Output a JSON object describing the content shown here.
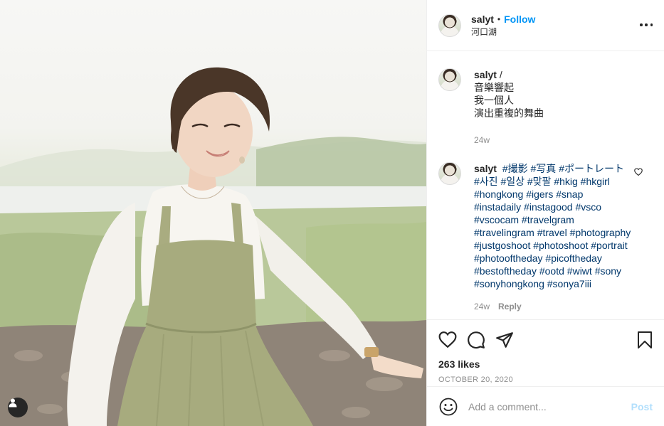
{
  "header": {
    "username": "salyt",
    "separator": "•",
    "follow_label": "Follow",
    "location": "河口湖"
  },
  "caption": {
    "username": "salyt",
    "text_suffix": "/",
    "lines": [
      "音樂響起",
      "我一個人",
      "演出重複的舞曲"
    ],
    "time": "24w"
  },
  "hashtag_comment": {
    "username": "salyt",
    "tags": [
      "#撮影",
      "#写真",
      "#ポートレート",
      "#사진",
      "#일상",
      "#맞팔",
      "#hkig",
      "#hkgirl",
      "#hongkong",
      "#igers",
      "#snap",
      "#instadaily",
      "#instagood",
      "#vsco",
      "#vscocam",
      "#travelgram",
      "#travelingram",
      "#travel",
      "#photography",
      "#justgoshoot",
      "#photoshoot",
      "#portrait",
      "#photooftheday",
      "#picoftheday",
      "#bestoftheday",
      "#ootd",
      "#wiwt",
      "#sony",
      "#sonyhongkong",
      "#sonya7iii"
    ],
    "time": "24w",
    "reply_label": "Reply"
  },
  "actions": {
    "like_icon": "heart-icon",
    "comment_icon": "comment-icon",
    "share_icon": "share-icon",
    "save_icon": "bookmark-icon"
  },
  "likes_text": "263 likes",
  "date_text": "OCTOBER 20, 2020",
  "comment_box": {
    "placeholder": "Add a comment...",
    "post_label": "Post"
  },
  "colors": {
    "accent": "#0095f6",
    "hashtag": "#00376b",
    "muted": "#8e8e8e",
    "post_disabled": "#b2dffc"
  }
}
